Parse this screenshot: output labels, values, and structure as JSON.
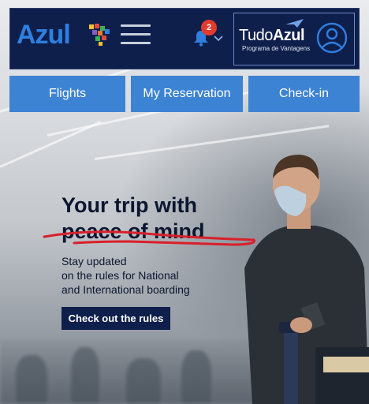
{
  "header": {
    "logo_text": "Azul",
    "notification_count": "2",
    "loyalty": {
      "brand_light": "Tudo",
      "brand_bold": "Azul",
      "subtitle": "Programa de Vantagens"
    }
  },
  "nav": {
    "items": [
      {
        "label": "Flights"
      },
      {
        "label": "My Reservation"
      },
      {
        "label": "Check-in"
      }
    ]
  },
  "hero": {
    "title_line1": "Your trip with",
    "title_line2": "peace of mind",
    "description_line1": "Stay updated",
    "description_line2": "on the rules for National",
    "description_line3": "and International boarding",
    "cta_label": "Check out the rules"
  },
  "colors": {
    "header_bg": "#0f1f4b",
    "brand_blue": "#2f7fe0",
    "nav_button": "#3d83d3",
    "badge_red": "#e23b2e",
    "scribble_red": "#d8202a"
  },
  "icons": [
    "brazil-map-icon",
    "menu-icon",
    "bell-icon",
    "chevron-down-icon",
    "plane-icon",
    "user-icon"
  ]
}
